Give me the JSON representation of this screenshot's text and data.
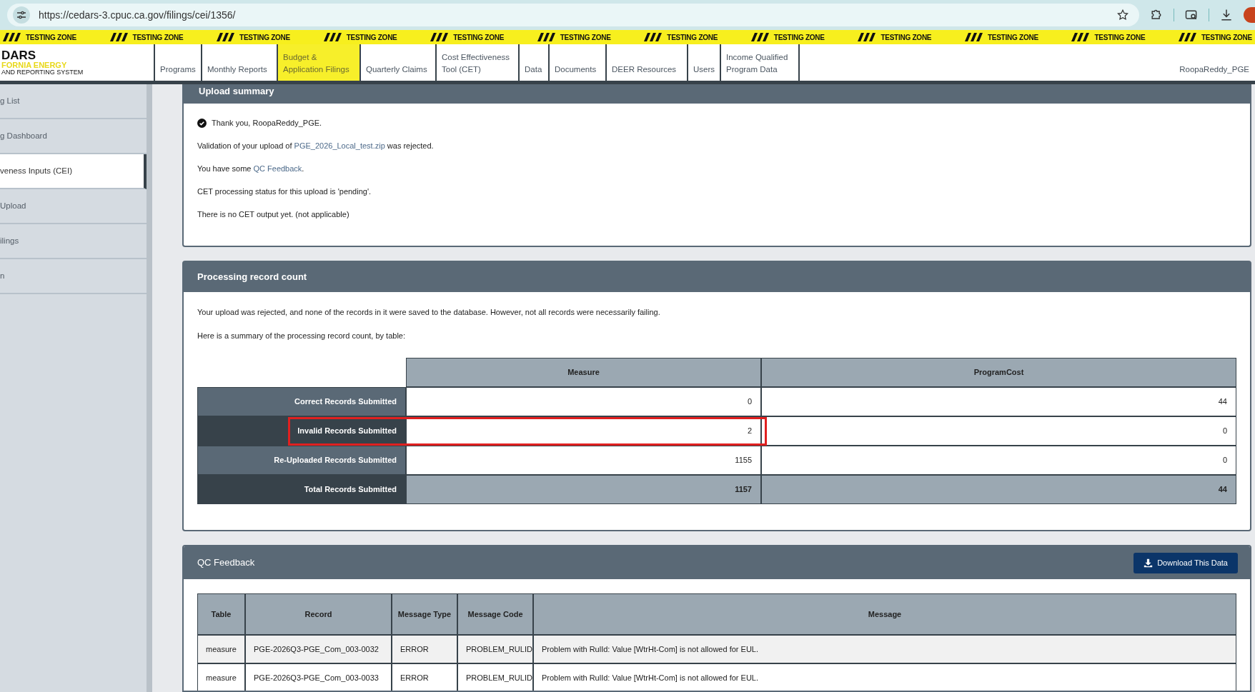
{
  "browser": {
    "url": "https://cedars-3.cpuc.ca.gov/filings/cei/1356/"
  },
  "testing_banner": [
    "TESTING ZONE",
    "TESTING ZONE",
    "TESTING ZONE",
    "TESTING ZONE",
    "TESTING ZONE",
    "TESTING ZONE",
    "TESTING ZONE",
    "TESTING ZONE",
    "TESTING ZONE",
    "TESTING ZONE",
    "TESTING ZONE",
    "TESTING ZONE"
  ],
  "logo": {
    "line_1": "DARS",
    "line_2": "FORNIA ENERGY",
    "line_3": "AND REPORTING SYSTEM"
  },
  "nav": [
    {
      "label": "Programs",
      "selected": false
    },
    {
      "label": "Monthly Reports",
      "selected": false
    },
    {
      "label": "Budget & Application Filings",
      "selected": true
    },
    {
      "label": "Quarterly Claims",
      "selected": false
    },
    {
      "label": "Cost Effectiveness Tool (CET)",
      "selected": false
    },
    {
      "label": "Data",
      "selected": false
    },
    {
      "label": "Documents",
      "selected": false
    },
    {
      "label": "DEER Resources",
      "selected": false
    },
    {
      "label": "Users",
      "selected": false
    },
    {
      "label": "Income Qualified Program Data",
      "selected": false
    }
  ],
  "user": "RoopaReddy_PGE",
  "sidebar": {
    "items": [
      {
        "label": "g List",
        "selected": false
      },
      {
        "label": "g Dashboard",
        "selected": false
      },
      {
        "label": "veness Inputs (CEI)",
        "selected": true
      },
      {
        "label": "Upload",
        "selected": false
      },
      {
        "label": "ilings",
        "selected": false
      },
      {
        "label": "n",
        "selected": false
      }
    ]
  },
  "upload_summary": {
    "title": "Upload summary",
    "lines": [
      {
        "kind": "check",
        "text": "Thank you, RoopaReddy_PGE."
      },
      {
        "kind": "link",
        "before": "Validation of your upload of ",
        "link": "PGE_2026_Local_test.zip",
        "after": " was rejected."
      },
      {
        "kind": "link",
        "before": "You have some ",
        "link": "QC Feedback",
        "after": "."
      },
      {
        "kind": "plain",
        "text": "CET processing status for this upload is 'pending'."
      },
      {
        "kind": "plain",
        "text": "There is no CET output yet. (not applicable)"
      }
    ]
  },
  "processing_record_count": {
    "title": "Processing record count",
    "paragraphs": [
      "Your upload was rejected, and none of the records in it were saved to the database. However, not all records were necessarily failing.",
      "Here is a summary of the processing record count, by table:"
    ],
    "columns": [
      "Measure",
      "ProgramCost"
    ],
    "rows": [
      {
        "label": "Correct Records Submitted",
        "values": [
          "0",
          "44"
        ],
        "highlighted": false,
        "total": false
      },
      {
        "label": "Invalid Records Submitted",
        "values": [
          "2",
          "0"
        ],
        "highlighted": true,
        "total": false
      },
      {
        "label": "Re-Uploaded Records Submitted",
        "values": [
          "1155",
          "0"
        ],
        "highlighted": false,
        "total": false
      },
      {
        "label": "Total Records Submitted",
        "values": [
          "1157",
          "44"
        ],
        "highlighted": false,
        "total": true
      }
    ]
  },
  "qc_feedback": {
    "title": "QC Feedback",
    "download_button": "Download This Data",
    "columns": [
      "Table",
      "Record",
      "Message Type",
      "Message Code",
      "Message"
    ],
    "rows": [
      [
        "measure",
        "PGE-2026Q3-PGE_Com_003-0032",
        "ERROR",
        "PROBLEM_RULID",
        "Problem with RulId: Value [WtrHt-Com] is not allowed for EUL."
      ],
      [
        "measure",
        "PGE-2026Q3-PGE_Com_003-0033",
        "ERROR",
        "PROBLEM_RULID",
        "Problem with RulId: Value [WtrHt-Com] is not allowed for EUL."
      ]
    ]
  }
}
